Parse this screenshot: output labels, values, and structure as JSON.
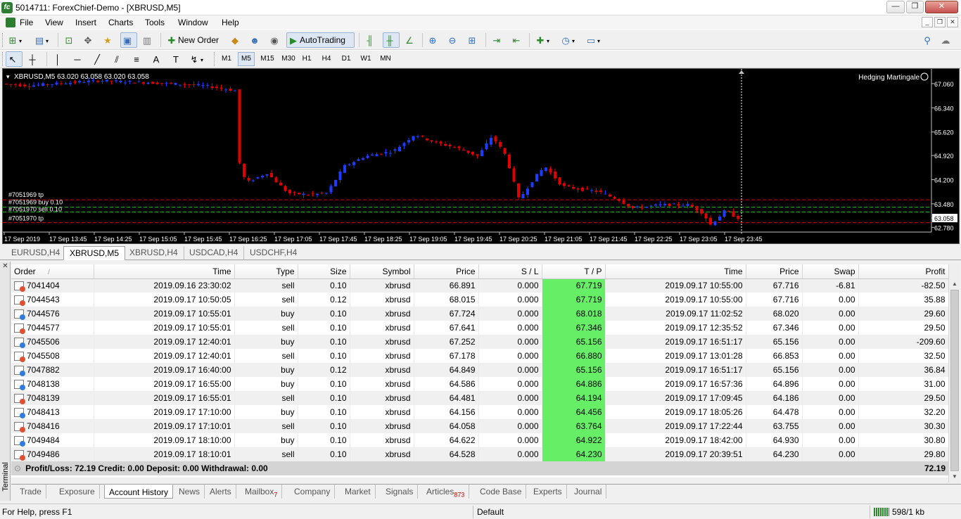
{
  "window": {
    "title": "5014711: ForexChief-Demo - [XBRUSD,M5]",
    "app_icon_text": "fc"
  },
  "menu": [
    "File",
    "View",
    "Insert",
    "Charts",
    "Tools",
    "Window",
    "Help"
  ],
  "toolbar": {
    "new_order_label": "New Order",
    "autotrading_label": "AutoTrading"
  },
  "timeframes": [
    "M1",
    "M5",
    "M15",
    "M30",
    "H1",
    "H4",
    "D1",
    "W1",
    "MN"
  ],
  "active_timeframe": "M5",
  "chart": {
    "header": "XBRUSD,M5  63.020 63.058 63.020 63.058",
    "ea_label": "Hedging Martingale",
    "price_labels": [
      "67.060",
      "66.340",
      "65.620",
      "64.920",
      "64.200",
      "63.480",
      "63.058",
      "62.780"
    ],
    "current_price": "63.058",
    "time_labels": [
      "17 Sep 2019",
      "17 Sep 13:45",
      "17 Sep 14:25",
      "17 Sep 15:05",
      "17 Sep 15:45",
      "17 Sep 16:25",
      "17 Sep 17:05",
      "17 Sep 17:45",
      "17 Sep 18:25",
      "17 Sep 19:05",
      "17 Sep 19:45",
      "17 Sep 20:25",
      "17 Sep 21:05",
      "17 Sep 21:45",
      "17 Sep 22:25",
      "17 Sep 23:05",
      "17 Sep 23:45"
    ],
    "order_labels": [
      "#7051969 tp",
      "#7051969 buy 0.10",
      "#7051970 sell 0.10",
      "#7051970 tp"
    ],
    "colors": {
      "bull": "#1e3cff",
      "bear": "#e00000",
      "tp_line": "#e00000",
      "order_line": "#19c819"
    }
  },
  "chart_tabs": [
    "EURUSD,H4",
    "XBRUSD,M5",
    "XBRUSD,H4",
    "USDCAD,H4",
    "USDCHF,H4"
  ],
  "active_chart_tab": "XBRUSD,M5",
  "terminal": {
    "side_label": "Terminal",
    "columns": [
      "Order",
      "Time",
      "Type",
      "Size",
      "Symbol",
      "Price",
      "S / L",
      "T / P",
      "Time",
      "Price",
      "Swap",
      "Profit"
    ],
    "sort_marker": "/",
    "rows": [
      [
        "7041404",
        "2019.09.16 23:30:02",
        "sell",
        "0.10",
        "xbrusd",
        "66.891",
        "0.000",
        "67.719",
        "2019.09.17 10:55:00",
        "67.716",
        "-6.81",
        "-82.50"
      ],
      [
        "7044543",
        "2019.09.17 10:50:05",
        "sell",
        "0.12",
        "xbrusd",
        "68.015",
        "0.000",
        "67.719",
        "2019.09.17 10:55:00",
        "67.716",
        "0.00",
        "35.88"
      ],
      [
        "7044576",
        "2019.09.17 10:55:01",
        "buy",
        "0.10",
        "xbrusd",
        "67.724",
        "0.000",
        "68.018",
        "2019.09.17 11:02:52",
        "68.020",
        "0.00",
        "29.60"
      ],
      [
        "7044577",
        "2019.09.17 10:55:01",
        "sell",
        "0.10",
        "xbrusd",
        "67.641",
        "0.000",
        "67.346",
        "2019.09.17 12:35:52",
        "67.346",
        "0.00",
        "29.50"
      ],
      [
        "7045506",
        "2019.09.17 12:40:01",
        "buy",
        "0.10",
        "xbrusd",
        "67.252",
        "0.000",
        "65.156",
        "2019.09.17 16:51:17",
        "65.156",
        "0.00",
        "-209.60"
      ],
      [
        "7045508",
        "2019.09.17 12:40:01",
        "sell",
        "0.10",
        "xbrusd",
        "67.178",
        "0.000",
        "66.880",
        "2019.09.17 13:01:28",
        "66.853",
        "0.00",
        "32.50"
      ],
      [
        "7047882",
        "2019.09.17 16:40:00",
        "buy",
        "0.12",
        "xbrusd",
        "64.849",
        "0.000",
        "65.156",
        "2019.09.17 16:51:17",
        "65.156",
        "0.00",
        "36.84"
      ],
      [
        "7048138",
        "2019.09.17 16:55:00",
        "buy",
        "0.10",
        "xbrusd",
        "64.586",
        "0.000",
        "64.886",
        "2019.09.17 16:57:36",
        "64.896",
        "0.00",
        "31.00"
      ],
      [
        "7048139",
        "2019.09.17 16:55:01",
        "sell",
        "0.10",
        "xbrusd",
        "64.481",
        "0.000",
        "64.194",
        "2019.09.17 17:09:45",
        "64.186",
        "0.00",
        "29.50"
      ],
      [
        "7048413",
        "2019.09.17 17:10:00",
        "buy",
        "0.10",
        "xbrusd",
        "64.156",
        "0.000",
        "64.456",
        "2019.09.17 18:05:26",
        "64.478",
        "0.00",
        "32.20"
      ],
      [
        "7048416",
        "2019.09.17 17:10:01",
        "sell",
        "0.10",
        "xbrusd",
        "64.058",
        "0.000",
        "63.764",
        "2019.09.17 17:22:44",
        "63.755",
        "0.00",
        "30.30"
      ],
      [
        "7049484",
        "2019.09.17 18:10:00",
        "buy",
        "0.10",
        "xbrusd",
        "64.622",
        "0.000",
        "64.922",
        "2019.09.17 18:42:00",
        "64.930",
        "0.00",
        "30.80"
      ],
      [
        "7049486",
        "2019.09.17 18:10:01",
        "sell",
        "0.10",
        "xbrusd",
        "64.528",
        "0.000",
        "64.230",
        "2019.09.17 20:39:51",
        "64.230",
        "0.00",
        "29.80"
      ]
    ],
    "summary": "Profit/Loss: 72.19  Credit: 0.00  Deposit: 0.00  Withdrawal: 0.00",
    "summary_total": "72.19",
    "tabs": [
      {
        "label": "Trade"
      },
      {
        "label": "Exposure"
      },
      {
        "label": "Account History"
      },
      {
        "label": "News"
      },
      {
        "label": "Alerts"
      },
      {
        "label": "Mailbox",
        "badge": "7"
      },
      {
        "label": "Company"
      },
      {
        "label": "Market"
      },
      {
        "label": "Signals"
      },
      {
        "label": "Articles",
        "badge": "873"
      },
      {
        "label": "Code Base"
      },
      {
        "label": "Experts"
      },
      {
        "label": "Journal"
      }
    ],
    "active_tab": "Account History"
  },
  "status": {
    "help": "For Help, press F1",
    "profile": "Default",
    "traffic": "598/1 kb"
  }
}
